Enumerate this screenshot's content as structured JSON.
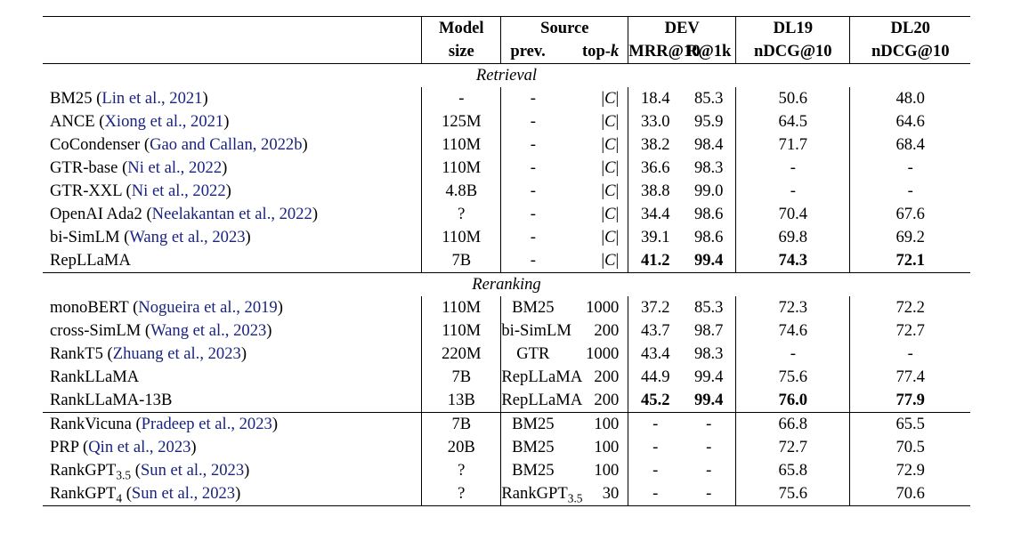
{
  "headers": {
    "model_size_top": "Model",
    "model_size_bot": "size",
    "source_top": "Source",
    "source_prev": "prev.",
    "source_topk_prefix": "top-",
    "source_topk_var": "k",
    "dev_top": "DEV",
    "dev_mrr": "MRR@10",
    "dev_r1k": "R@1k",
    "dl19_top": "DL19",
    "dl19_bot": "nDCG@10",
    "dl20_top": "DL20",
    "dl20_bot": "nDCG@10"
  },
  "sections": {
    "retrieval": "Retrieval",
    "reranking": "Reranking"
  },
  "absC": "|C|",
  "rows_retrieval": [
    {
      "method": "BM25",
      "cite": "Lin et al., 2021",
      "size": "-",
      "prev": "-",
      "topk": "|C|",
      "mrr": "18.4",
      "r1k": "85.3",
      "d19": "50.6",
      "d20": "48.0",
      "bold": false
    },
    {
      "method": "ANCE",
      "cite": "Xiong et al., 2021",
      "size": "125M",
      "prev": "-",
      "topk": "|C|",
      "mrr": "33.0",
      "r1k": "95.9",
      "d19": "64.5",
      "d20": "64.6",
      "bold": false
    },
    {
      "method": "CoCondenser",
      "cite": "Gao and Callan, 2022b",
      "size": "110M",
      "prev": "-",
      "topk": "|C|",
      "mrr": "38.2",
      "r1k": "98.4",
      "d19": "71.7",
      "d20": "68.4",
      "bold": false
    },
    {
      "method": "GTR-base",
      "cite": "Ni et al., 2022",
      "size": "110M",
      "prev": "-",
      "topk": "|C|",
      "mrr": "36.6",
      "r1k": "98.3",
      "d19": "-",
      "d20": "-",
      "bold": false
    },
    {
      "method": "GTR-XXL",
      "cite": "Ni et al., 2022",
      "size": "4.8B",
      "prev": "-",
      "topk": "|C|",
      "mrr": "38.8",
      "r1k": "99.0",
      "d19": "-",
      "d20": "-",
      "bold": false
    },
    {
      "method": "OpenAI Ada2",
      "cite": "Neelakantan et al., 2022",
      "size": "?",
      "prev": "-",
      "topk": "|C|",
      "mrr": "34.4",
      "r1k": "98.6",
      "d19": "70.4",
      "d20": "67.6",
      "bold": false
    },
    {
      "method": "bi-SimLM",
      "cite": "Wang et al., 2023",
      "size": "110M",
      "prev": "-",
      "topk": "|C|",
      "mrr": "39.1",
      "r1k": "98.6",
      "d19": "69.8",
      "d20": "69.2",
      "bold": false
    },
    {
      "method": "RepLLaMA",
      "cite": "",
      "size": "7B",
      "prev": "-",
      "topk": "|C|",
      "mrr": "41.2",
      "r1k": "99.4",
      "d19": "74.3",
      "d20": "72.1",
      "bold": true
    }
  ],
  "rows_rerank_a": [
    {
      "method": "monoBERT",
      "cite": "Nogueira et al., 2019",
      "size": "110M",
      "prev": "BM25",
      "topk": "1000",
      "mrr": "37.2",
      "r1k": "85.3",
      "d19": "72.3",
      "d20": "72.2",
      "bold": false
    },
    {
      "method": "cross-SimLM",
      "cite": "Wang et al., 2023",
      "size": "110M",
      "prev": "bi-SimLM",
      "topk": "200",
      "mrr": "43.7",
      "r1k": "98.7",
      "d19": "74.6",
      "d20": "72.7",
      "bold": false
    },
    {
      "method": "RankT5",
      "cite": "Zhuang et al., 2023",
      "size": "220M",
      "prev": "GTR",
      "topk": "1000",
      "mrr": "43.4",
      "r1k": "98.3",
      "d19": "-",
      "d20": "-",
      "bold": false
    },
    {
      "method": "RankLLaMA",
      "cite": "",
      "size": "7B",
      "prev": "RepLLaMA",
      "topk": "200",
      "mrr": "44.9",
      "r1k": "99.4",
      "d19": "75.6",
      "d20": "77.4",
      "bold": false
    },
    {
      "method": "RankLLaMA-13B",
      "cite": "",
      "size": "13B",
      "prev": "RepLLaMA",
      "topk": "200",
      "mrr": "45.2",
      "r1k": "99.4",
      "d19": "76.0",
      "d20": "77.9",
      "bold": true
    }
  ],
  "rows_rerank_b": [
    {
      "method": "RankVicuna",
      "cite": "Pradeep et al., 2023",
      "size": "7B",
      "prev": "BM25",
      "topk": "100",
      "mrr": "-",
      "r1k": "-",
      "d19": "66.8",
      "d20": "65.5",
      "bold": false
    },
    {
      "method": "PRP",
      "cite": "Qin et al., 2023",
      "size": "20B",
      "prev": "BM25",
      "topk": "100",
      "mrr": "-",
      "r1k": "-",
      "d19": "72.7",
      "d20": "70.5",
      "bold": false
    },
    {
      "method_html": "RankGPT<sub>3.5</sub>",
      "cite": "Sun et al., 2023",
      "size": "?",
      "prev": "BM25",
      "topk": "100",
      "mrr": "-",
      "r1k": "-",
      "d19": "65.8",
      "d20": "72.9",
      "bold": false
    },
    {
      "method_html": "RankGPT<sub>4</sub>",
      "cite": "Sun et al., 2023",
      "size": "?",
      "prev_html": "RankGPT<sub>3.5</sub>",
      "topk": "30",
      "mrr": "-",
      "r1k": "-",
      "d19": "75.6",
      "d20": "70.6",
      "bold": false
    }
  ]
}
